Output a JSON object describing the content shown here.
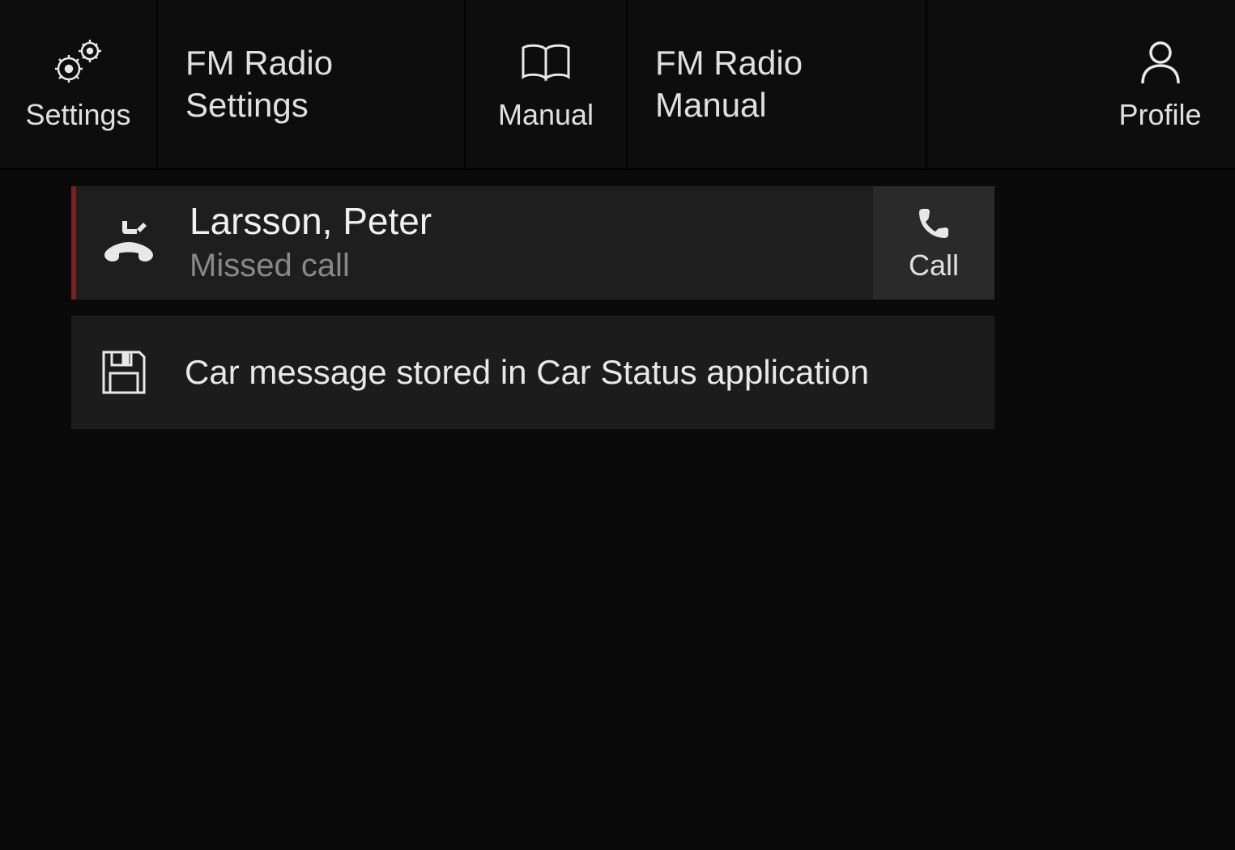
{
  "toolbar": {
    "settings": {
      "label": "Settings"
    },
    "fm_radio_settings": {
      "line1": "FM Radio",
      "line2": "Settings"
    },
    "manual": {
      "label": "Manual"
    },
    "fm_radio_manual": {
      "line1": "FM Radio",
      "line2": "Manual"
    },
    "profile": {
      "label": "Profile"
    }
  },
  "notifications": {
    "missed_call": {
      "name": "Larsson, Peter",
      "status": "Missed call",
      "action_label": "Call"
    },
    "car_message": {
      "text": "Car message stored in Car Status application"
    }
  }
}
